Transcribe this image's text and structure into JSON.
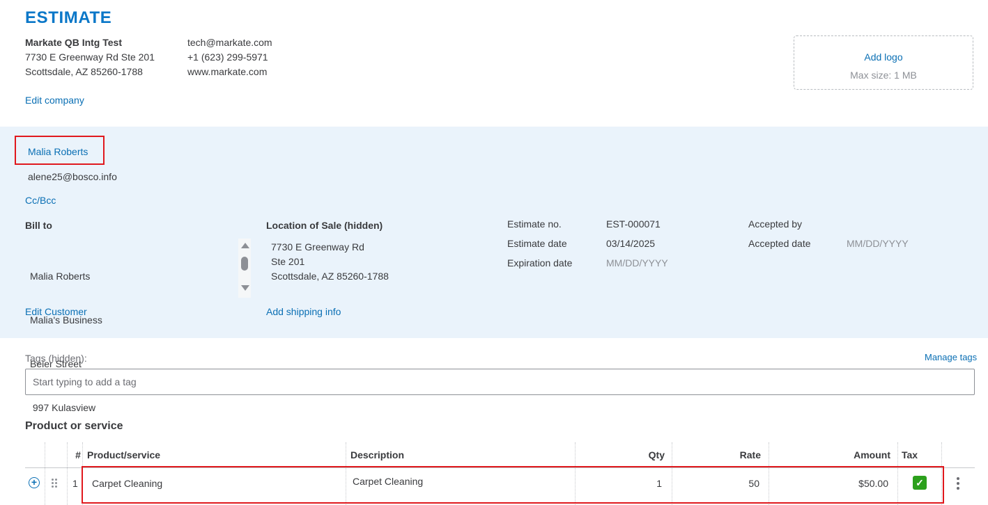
{
  "header": {
    "title": "ESTIMATE"
  },
  "company": {
    "name": "Markate QB Intg Test",
    "address_line1": "7730 E Greenway Rd Ste 201",
    "address_line2": "Scottsdale, AZ 85260-1788",
    "email": "tech@markate.com",
    "phone": "+1 (623) 299-5971",
    "website": "www.markate.com",
    "edit_link": "Edit company"
  },
  "logo": {
    "add_label": "Add logo",
    "max_size": "Max size: 1 MB"
  },
  "customer": {
    "name": "Malia Roberts",
    "email": "alene25@bosco.info",
    "cc_bcc": "Cc/Bcc"
  },
  "bill_to": {
    "label": "Bill to",
    "lines": [
      "Malia Roberts",
      "Malia's Business",
      "Beier Street",
      " 997 Kulasview"
    ],
    "edit_link": "Edit Customer"
  },
  "location": {
    "label": "Location of Sale (hidden)",
    "lines": [
      "7730 E Greenway Rd",
      "Ste 201",
      "Scottsdale, AZ 85260-1788"
    ],
    "shipping_link": "Add shipping info"
  },
  "estimate_info": {
    "number_label": "Estimate no.",
    "number_value": "EST-000071",
    "date_label": "Estimate date",
    "date_value": "03/14/2025",
    "expiration_label": "Expiration date",
    "expiration_placeholder": "MM/DD/YYYY",
    "accepted_by_label": "Accepted by",
    "accepted_date_label": "Accepted date",
    "accepted_date_placeholder": "MM/DD/YYYY"
  },
  "tags": {
    "label": "Tags (hidden):",
    "manage_link": "Manage tags",
    "placeholder": "Start typing to add a tag"
  },
  "products": {
    "section_title": "Product or service",
    "columns": [
      "#",
      "Product/service",
      "Description",
      "Qty",
      "Rate",
      "Amount",
      "Tax"
    ],
    "rows": [
      {
        "num": "1",
        "product": "Carpet Cleaning",
        "description": "Carpet Cleaning",
        "qty": "1",
        "rate": "50",
        "amount": "$50.00",
        "tax": true
      }
    ]
  },
  "colors": {
    "accent": "#0a77c8",
    "link": "#0a6fb4",
    "band": "#eaf3fb",
    "highlight": "#e0181d",
    "tax_check": "#2ca01c"
  }
}
